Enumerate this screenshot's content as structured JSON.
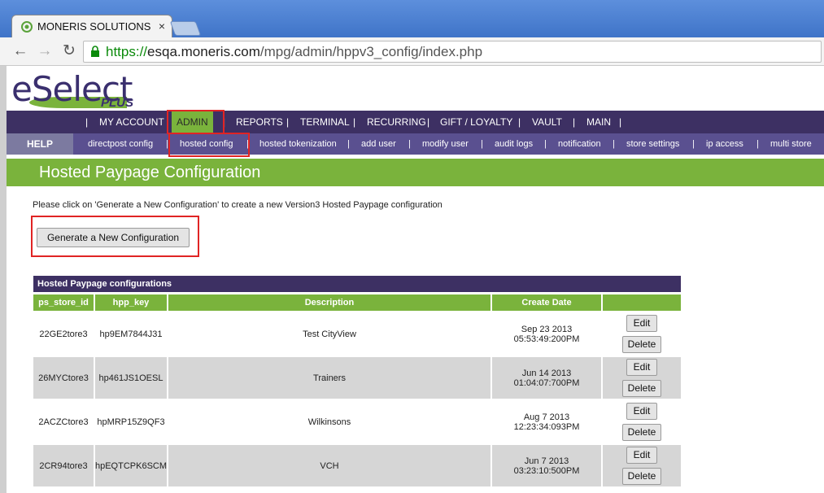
{
  "browser": {
    "tab_title": "MONERIS SOLUTIONS - e",
    "tab_close": "×",
    "url_scheme": "https://",
    "url_host": "esqa.moneris.com",
    "url_path": "/mpg/admin/hppv3_config/index.php",
    "back": "←",
    "forward": "→",
    "reload": "↻"
  },
  "logo": {
    "main": "eSelect",
    "sub": "PLUS"
  },
  "main_nav": {
    "items": [
      "MY ACCOUNT",
      "ADMIN",
      "REPORTS",
      "TERMINAL",
      "RECURRING",
      "GIFT / LOYALTY",
      "VAULT",
      "MAIN"
    ],
    "active": "ADMIN"
  },
  "sub_nav": {
    "help": "HELP",
    "items": [
      "directpost config",
      "hosted config",
      "hosted tokenization",
      "add user",
      "modify user",
      "audit logs",
      "notification",
      "store settings",
      "ip access",
      "multi store"
    ],
    "active": "hosted config"
  },
  "page_title": "Hosted Paypage Configuration",
  "intro_text": "Please click on 'Generate a New Configuration' to create a new Version3 Hosted Paypage configuration",
  "generate_button": "Generate a New Configuration",
  "table": {
    "title": "Hosted Paypage configurations",
    "headers": [
      "ps_store_id",
      "hpp_key",
      "Description",
      "Create Date"
    ],
    "edit_label": "Edit",
    "delete_label": "Delete",
    "rows": [
      {
        "store": "22GE2tore3",
        "key": "hp9EM7844J31",
        "desc": "Test CityView",
        "date1": "Sep 23 2013",
        "date2": "05:53:49:200PM"
      },
      {
        "store": "26MYCtore3",
        "key": "hp461JS1OESL",
        "desc": "Trainers",
        "date1": "Jun 14 2013",
        "date2": "01:04:07:700PM"
      },
      {
        "store": "2ACZCtore3",
        "key": "hpMRP15Z9QF3",
        "desc": "Wilkinsons",
        "date1": "Aug 7 2013",
        "date2": "12:23:34:093PM"
      },
      {
        "store": "2CR94tore3",
        "key": "hpEQTCPK6SCM",
        "desc": "VCH",
        "date1": "Jun 7 2013 03:23:10:500PM",
        "date2": ""
      }
    ]
  },
  "colors": {
    "nav": "#3d3063",
    "subnav": "#5a5090",
    "accent": "#7ab33c",
    "highlight": "#e02424"
  }
}
